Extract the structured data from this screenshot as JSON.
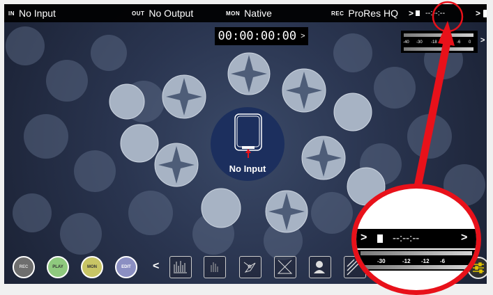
{
  "topbar": {
    "in_tag": "IN",
    "in_value": "No Input",
    "out_tag": "OUT",
    "out_value": "No Output",
    "mon_tag": "MON",
    "mon_value": "Native",
    "rec_tag": "REC",
    "rec_value": "ProRes HQ",
    "chevron": ">",
    "timecode_remaining": "--:--:--"
  },
  "timecode": {
    "value": "00:00:00:00",
    "chevron": ">"
  },
  "meter": {
    "labels": [
      "-40",
      "-30",
      "-18",
      "-12",
      "-6",
      "0"
    ],
    "chevron": ">"
  },
  "center": {
    "status_label": "No Input"
  },
  "buttons": {
    "rec": "REC",
    "play": "PLAY",
    "mon": "MON",
    "edit": "EDIT",
    "back_chevron": "<"
  },
  "tools": [
    "waveform-icon",
    "vectorscope-icon",
    "scatter-icon",
    "crosshatch-icon",
    "person-icon",
    "zebra-icon"
  ],
  "zoom": {
    "chevron_left": ">",
    "timecode": "--:--:--",
    "chevron_right": ">",
    "meter_labels": [
      "-30",
      "-12",
      "-12",
      "-6"
    ]
  },
  "colors": {
    "accent_red": "#e8111a",
    "disc_blue": "#1c2f5e",
    "play_green": "#8fc97e",
    "mon_yellow": "#c8c565",
    "edit_purple": "#8b8fc2"
  }
}
